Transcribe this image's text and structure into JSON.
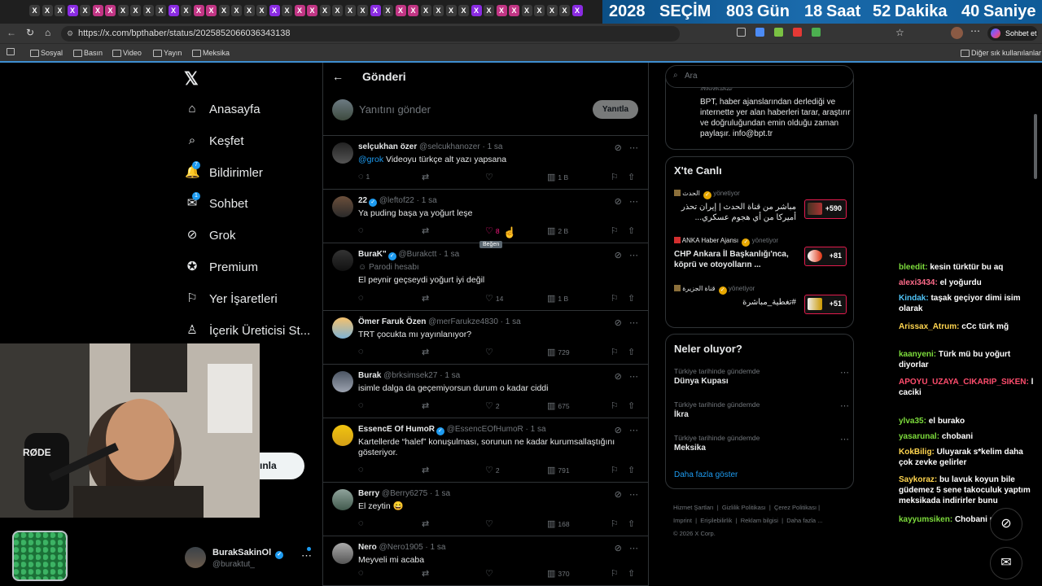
{
  "browser": {
    "tabs": [
      "X",
      "X",
      "X",
      "X",
      "X",
      "X",
      "X",
      "X",
      "X",
      "X",
      "X",
      "X",
      "X",
      "X",
      "X",
      "X",
      "X",
      "X",
      "X",
      "X",
      "X",
      "X",
      "X",
      "X",
      "X",
      "X",
      "X",
      "X",
      "X",
      "X",
      "X",
      "X",
      "X",
      "X",
      "X",
      "X",
      "X",
      "X",
      "X",
      "X",
      "X",
      "X",
      "X",
      "X"
    ],
    "countdown": [
      "2028",
      "SEÇİM",
      "803",
      "Gün",
      "18",
      "Saat",
      "52",
      "Dakika",
      "40",
      "Saniye"
    ],
    "url": "https://x.com/bpthaber/status/2025852066036343138",
    "chat_label": "Sohbet et",
    "bookmarks": [
      "Sosyal",
      "Basın",
      "Video",
      "Yayın",
      "Meksika"
    ],
    "other_bookmarks": "Diğer sık kullanılanlar"
  },
  "nav": {
    "items": [
      {
        "label": "Anasayfa",
        "icon": "home-icon"
      },
      {
        "label": "Keşfet",
        "icon": "search-icon"
      },
      {
        "label": "Bildirimler",
        "icon": "bell-icon",
        "badge": "7"
      },
      {
        "label": "Sohbet",
        "icon": "mail-icon",
        "badge": "1"
      },
      {
        "label": "Grok",
        "icon": "grok-icon"
      },
      {
        "label": "Premium",
        "icon": "premium-icon"
      },
      {
        "label": "Yer İşaretleri",
        "icon": "bookmark-icon"
      },
      {
        "label": "İçerik Üreticisi St...",
        "icon": "creator-icon"
      }
    ],
    "post_button_partial": "ınla",
    "profile_name": "BurakSakinOl",
    "profile_handle": "@buraktut_"
  },
  "main": {
    "title": "Gönderi",
    "reply_placeholder": "Yanıtını gönder",
    "reply_button": "Yanıtla",
    "tooltip": "Beğen",
    "posts": [
      {
        "name": "selçukhan özer",
        "handle": "@selcukhanozer",
        "time": "1 sa",
        "verified": false,
        "text_mention": "@grok",
        "text": "Videoyu türkçe alt yazı yapsana",
        "replies": "1",
        "retweets": "",
        "likes": "",
        "views": "1 B"
      },
      {
        "name": "22",
        "handle": "@leftof22",
        "time": "1 sa",
        "verified": true,
        "text": "Ya puding başa ya yoğurt leşe",
        "replies": "",
        "retweets": "",
        "likes": "8",
        "views": "2 B"
      },
      {
        "name": "BuraK\"",
        "handle": "@Burakctt",
        "time": "1 sa",
        "verified": true,
        "sub": "Parodi hesabı",
        "text": "El peynir geçseydi yoğurt iyi değil",
        "replies": "",
        "retweets": "",
        "likes": "14",
        "views": "1 B"
      },
      {
        "name": "Ömer Faruk Özen",
        "handle": "@merFarukze4830",
        "time": "1 sa",
        "verified": false,
        "text": "TRT çocukta mı yayınlanıyor?",
        "replies": "",
        "retweets": "",
        "likes": "",
        "views": "729"
      },
      {
        "name": "Burak",
        "handle": "@brksimsek27",
        "time": "1 sa",
        "verified": false,
        "text": "isimle dalga da geçemiyorsun durum o kadar ciddi",
        "replies": "",
        "retweets": "",
        "likes": "2",
        "views": "675"
      },
      {
        "name": "EssencE Of HumoR",
        "handle": "@EssencEOfHumoR",
        "time": "1 sa",
        "verified": true,
        "text": "Kartellerde “halef” konuşulması, sorunun ne kadar kurumsallaştığını gösteriyor.",
        "replies": "",
        "retweets": "",
        "likes": "2",
        "views": "791"
      },
      {
        "name": "Berry",
        "handle": "@Berry6275",
        "time": "1 sa",
        "verified": false,
        "text": "El zeytin 😄",
        "replies": "",
        "retweets": "",
        "likes": "",
        "views": "168"
      },
      {
        "name": "Nero",
        "handle": "@Nero1905",
        "time": "1 sa",
        "verified": false,
        "text": "Meyveli mi acaba",
        "replies": "",
        "retweets": "",
        "likes": "",
        "views": "370"
      }
    ]
  },
  "right": {
    "search_placeholder": "Ara",
    "bio_handle": "@bpthaber",
    "bio_text": "BPT, haber ajanslarından derlediği ve internette yer alan haberleri tarar, araştırır ve doğruluğundan emin olduğu zaman paylaşır. info@bpt.tr",
    "live_title": "X'te Canlı",
    "live": [
      {
        "source": "الحدث",
        "status": "yönetiyor",
        "text": "مباشر من قناة الحدث | إيران تحذر أميركا من أي هجوم عسكري...",
        "count": "+590"
      },
      {
        "source": "ANKA Haber Ajansı",
        "status": "yönetiyor",
        "text": "CHP Ankara İl Başkanlığı'nca, köprü ve otoyolların ...",
        "count": "+81"
      },
      {
        "source": "قناة الجزيرة",
        "status": "yönetiyor",
        "text": "#تغطية_مباشرة",
        "count": "+51"
      }
    ],
    "trends_title": "Neler oluyor?",
    "trends": [
      {
        "meta": "Türkiye tarihinde gündemde",
        "label": "Dünya Kupası"
      },
      {
        "meta": "Türkiye tarihinde gündemde",
        "label": "İkra"
      },
      {
        "meta": "Türkiye tarihinde gündemde",
        "label": "Meksika"
      }
    ],
    "show_more": "Daha fazla göster",
    "footer_links": [
      "Hizmet Şartları",
      "Gizlilik Politikası",
      "Çerez Politikası",
      "Imprint",
      "Erişilebilirlik",
      "Reklam bilgisi",
      "Daha fazla ..."
    ],
    "copyright": "© 2026 X Corp."
  },
  "chat": [
    {
      "user": "bleedit:",
      "msg": "kesin türktür bu aq",
      "color": "#7ddc3c"
    },
    {
      "user": "alexi3434:",
      "msg": "el yoğurdu",
      "color": "#ff6b8a"
    },
    {
      "user": "Kindak:",
      "msg": "taşak geçiyor dimi isim olarak",
      "color": "#4fc3f7"
    },
    {
      "user": "Arissax_Atrum:",
      "msg": "cCc türk mğ",
      "color": "#ffd54f"
    },
    {
      "user": "kaanyeni:",
      "msg": "Türk mü bu yoğurt diyorlar",
      "color": "#7ddc3c"
    },
    {
      "user": "APOYU_UZAYA_CIKARIP_SIKEN:",
      "msg": "l caciki",
      "color": "#ff4d6d"
    },
    {
      "user": "ylva35:",
      "msg": "el burako",
      "color": "#7ddc3c"
    },
    {
      "user": "yasarunal:",
      "msg": "chobani",
      "color": "#7ddc3c"
    },
    {
      "user": "KokBilig:",
      "msg": "Uluyarak s*kelim daha çok zevke gelirler",
      "color": "#ffd54f"
    },
    {
      "user": "Saykoraz:",
      "msg": "bu lavuk koyun bile güdemez 5 sene takoculuk yaptım meksikada indirirler bunu",
      "color": "#ffd54f"
    },
    {
      "user": "kayyumsiken:",
      "msg": "Chobani mi?",
      "color": "#7ddc3c"
    }
  ],
  "webcam_brand": "RØDE"
}
